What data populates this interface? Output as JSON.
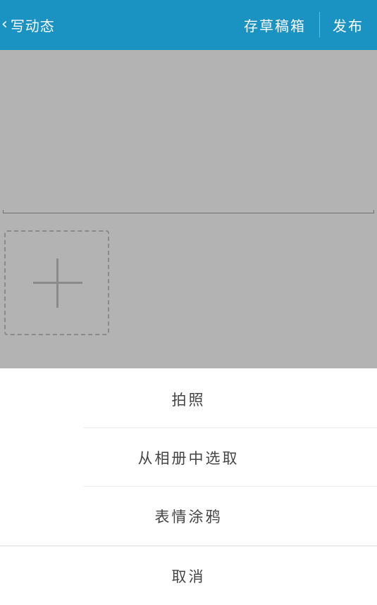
{
  "header": {
    "back_icon": "‹",
    "title": "写动态",
    "drafts_label": "存草稿箱",
    "publish_label": "发布"
  },
  "compose": {
    "placeholder": ""
  },
  "add_photo": {
    "icon": "plus-icon"
  },
  "action_sheet": {
    "items": [
      {
        "label": "拍照"
      },
      {
        "label": "从相册中选取"
      },
      {
        "label": "表情涂鸦"
      }
    ],
    "cancel_label": "取消"
  },
  "colors": {
    "header_bg": "#1a92c2",
    "overlay": "#b3b3b3",
    "sheet_bg": "#ffffff",
    "text": "#444444"
  }
}
